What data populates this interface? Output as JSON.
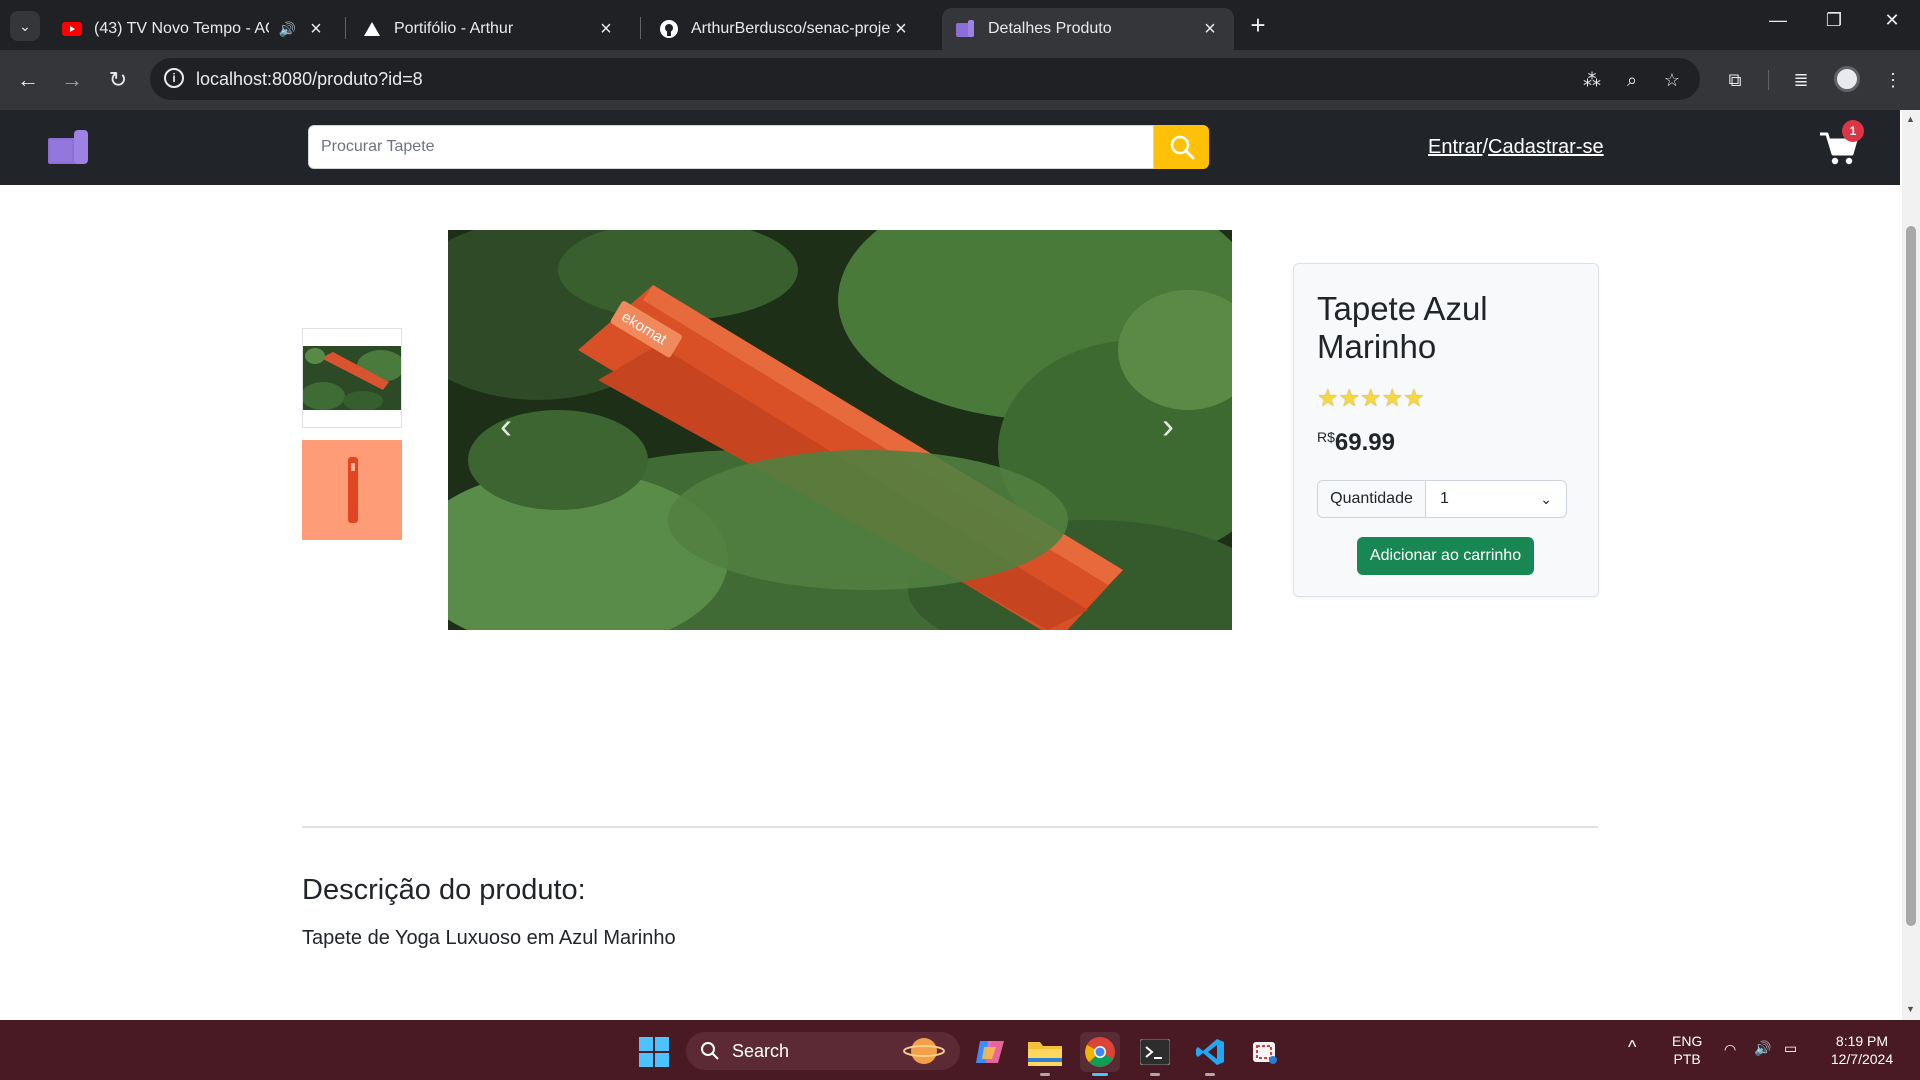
{
  "browser": {
    "tabs": [
      {
        "title": "(43) TV Novo Tempo - AO V",
        "icon": "youtube-icon",
        "audio": true
      },
      {
        "title": "Portifólio - Arthur",
        "icon": "triangle-logo-icon"
      },
      {
        "title": "ArthurBerdusco/senac-projeto-",
        "icon": "github-icon"
      },
      {
        "title": "Detalhes Produto",
        "icon": "site-favicon",
        "active": true
      }
    ],
    "url": "localhost:8080/produto?id=8"
  },
  "site": {
    "search_placeholder": "Procurar Tapete",
    "auth_login": "Entrar",
    "auth_sep": "/",
    "auth_register": "Cadastrar-se",
    "cart_count": "1",
    "colors": {
      "header": "#212529",
      "search_button": "#ffc107",
      "badge": "#dc3545",
      "add_button": "#198754",
      "logo": "#8b6fd6"
    }
  },
  "product": {
    "title": "Tapete Azul Marinho",
    "rating_stars": "★★★★★",
    "currency": "R$",
    "price": "69.99",
    "quantity_label": "Quantidade",
    "quantity_value": "1",
    "add_to_cart": "Adicionar ao carrinho",
    "description_title": "Descrição do produto:",
    "description": "Tapete de Yoga Luxuoso em Azul Marinho",
    "image_label": "ekomat"
  },
  "taskbar": {
    "search_label": "Search",
    "lang_line1": "ENG",
    "lang_line2": "PTB",
    "time": "8:19 PM",
    "date": "12/7/2024"
  }
}
